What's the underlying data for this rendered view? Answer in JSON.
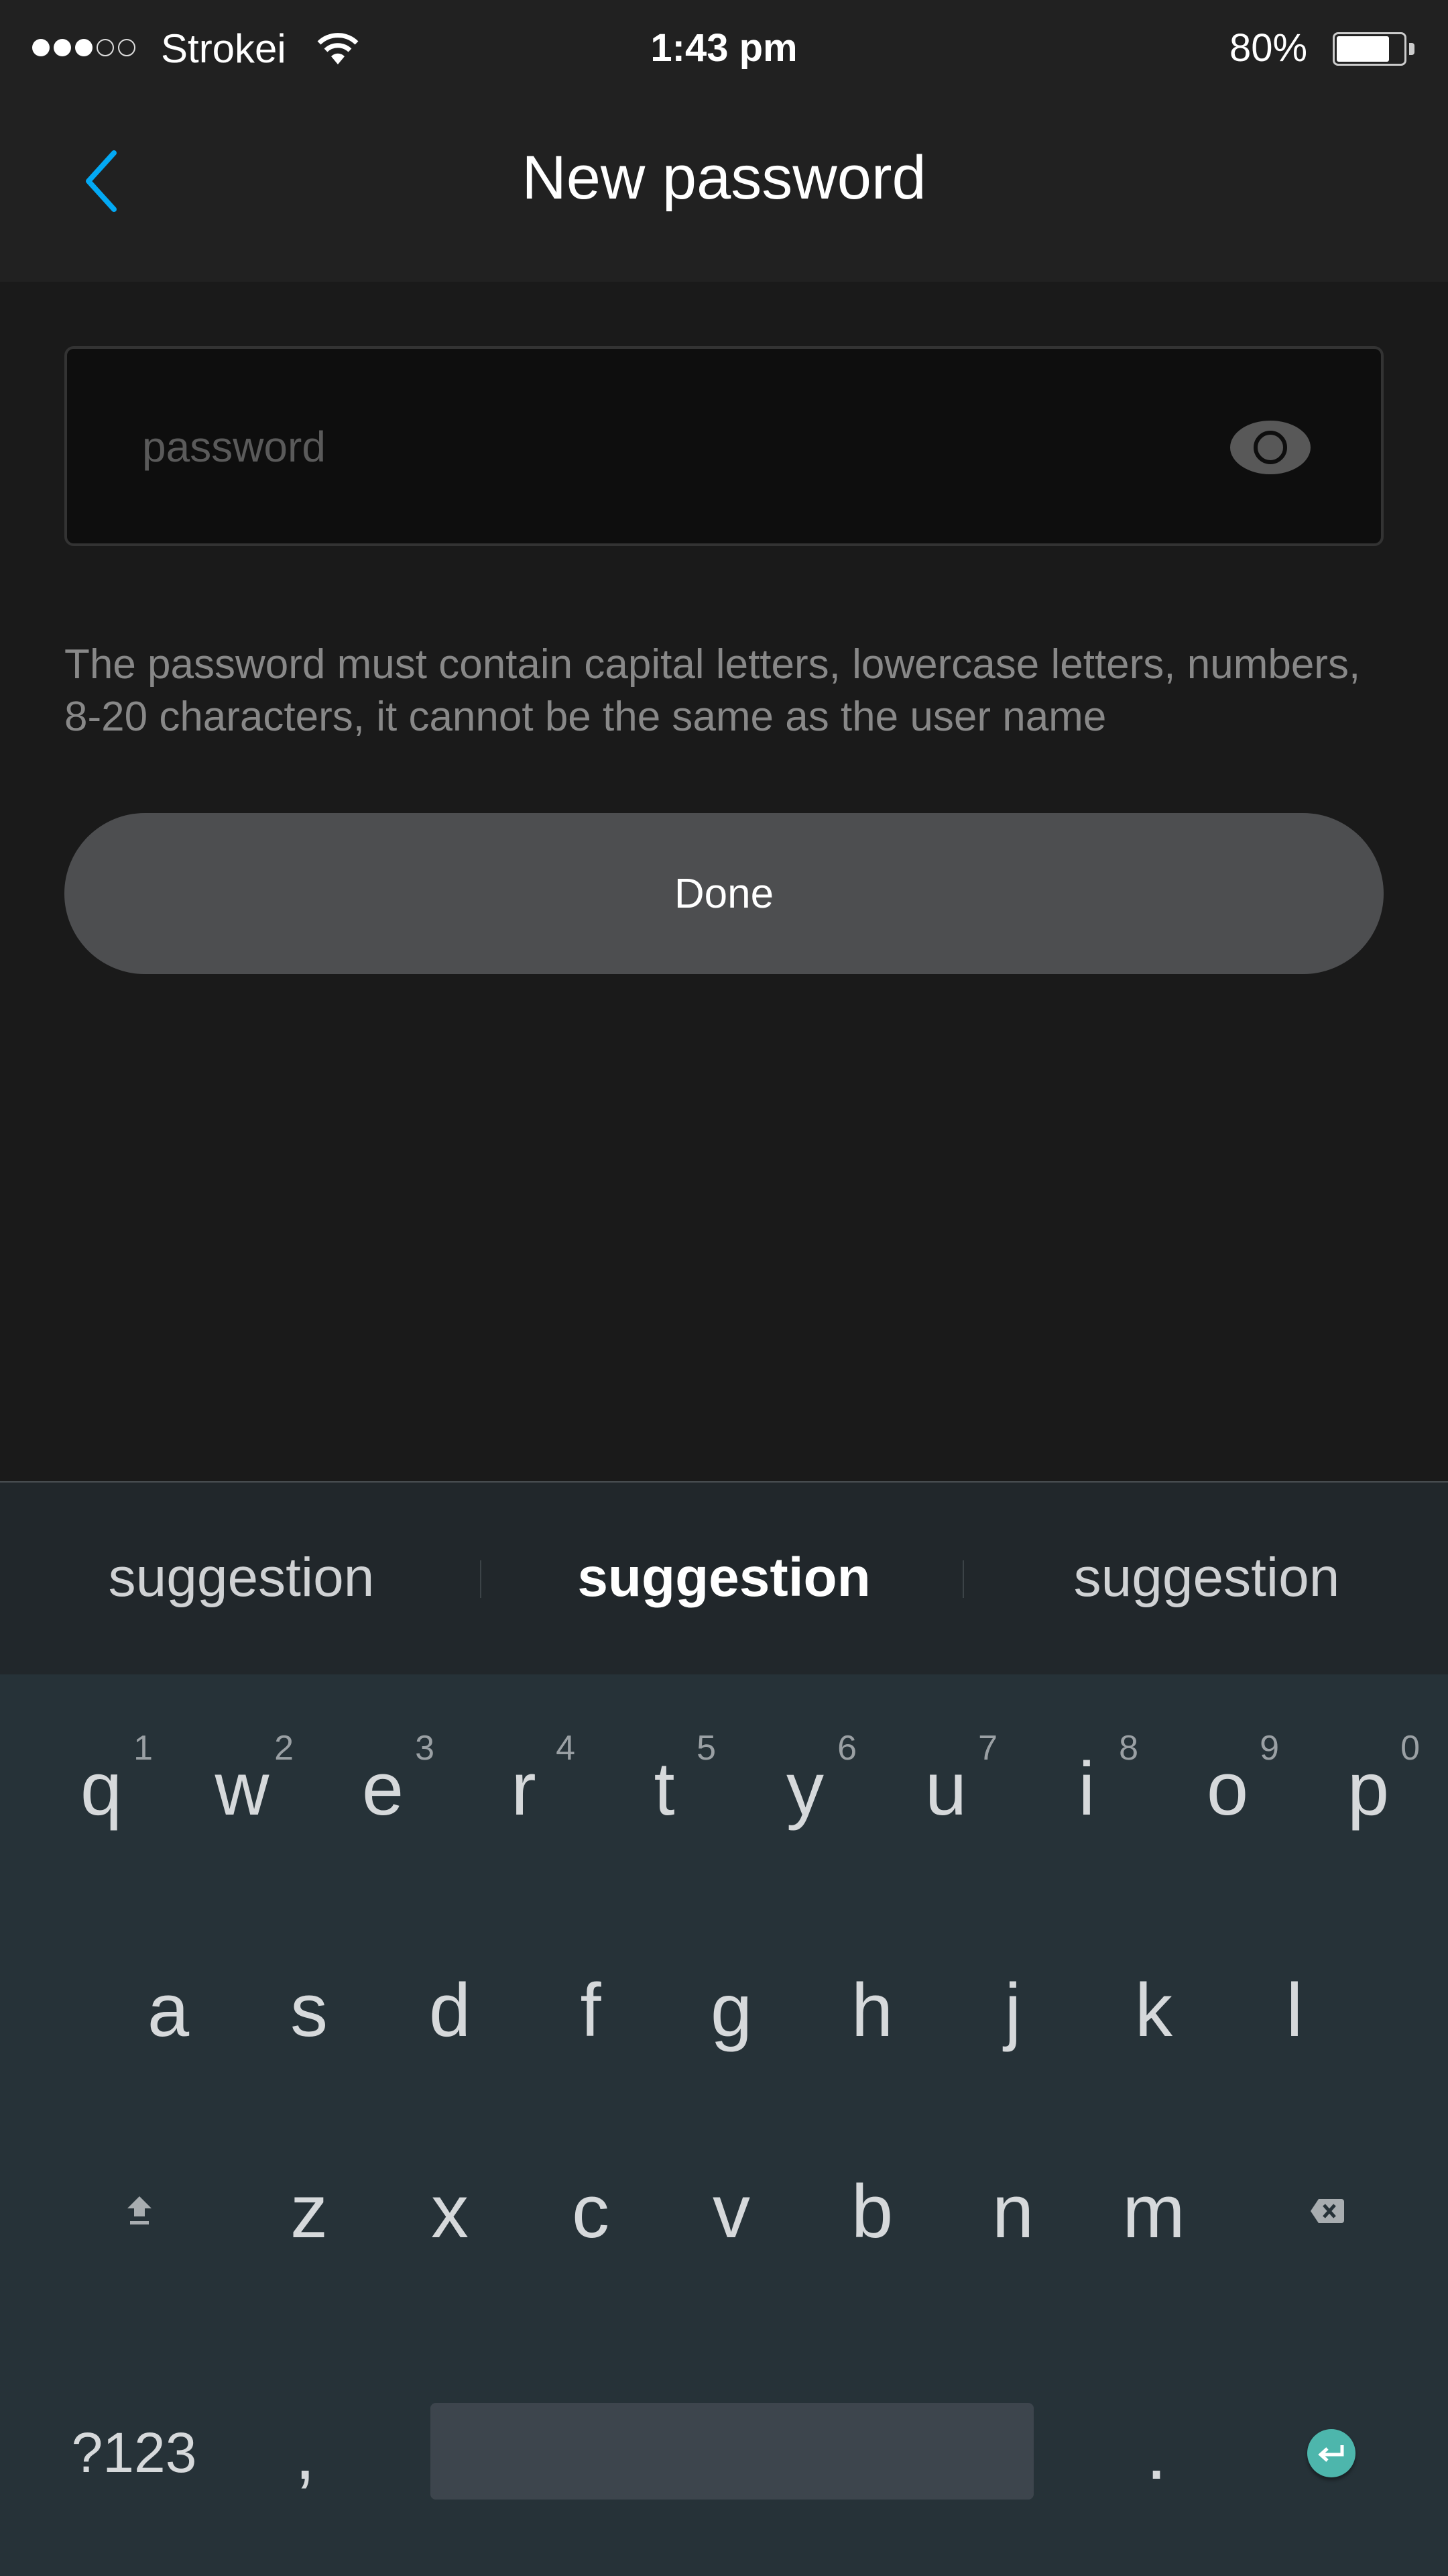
{
  "status_bar": {
    "signal_bars_filled": 3,
    "signal_bars_total": 5,
    "carrier": "Strokei",
    "wifi_icon": "wifi-icon",
    "time": "1:43 pm",
    "battery_percent_label": "80%",
    "battery_level": 0.8
  },
  "header": {
    "back_icon": "chevron-left-icon",
    "title": "New password",
    "accent_color": "#03a9f4"
  },
  "form": {
    "password_value": "",
    "password_placeholder": "password",
    "visibility_icon": "eye-icon",
    "hint": "The password must contain capital letters, lowercase letters, numbers, 8-20 characters, it cannot be the same as the user name",
    "done_label": "Done"
  },
  "keyboard": {
    "suggestions": [
      "suggestion",
      "suggestion",
      "suggestion"
    ],
    "row1": [
      {
        "key": "q",
        "num": "1"
      },
      {
        "key": "w",
        "num": "2"
      },
      {
        "key": "e",
        "num": "3"
      },
      {
        "key": "r",
        "num": "4"
      },
      {
        "key": "t",
        "num": "5"
      },
      {
        "key": "y",
        "num": "6"
      },
      {
        "key": "u",
        "num": "7"
      },
      {
        "key": "i",
        "num": "8"
      },
      {
        "key": "o",
        "num": "9"
      },
      {
        "key": "p",
        "num": "0"
      }
    ],
    "row2": [
      "a",
      "s",
      "d",
      "f",
      "g",
      "h",
      "j",
      "k",
      "l"
    ],
    "row3": [
      "z",
      "x",
      "c",
      "v",
      "b",
      "n",
      "m"
    ],
    "shift_icon": "shift-icon",
    "backspace_icon": "backspace-icon",
    "symbols_label": "?123",
    "comma_label": ",",
    "period_label": ".",
    "enter_icon": "enter-icon",
    "enter_color": "#4db6ac"
  }
}
